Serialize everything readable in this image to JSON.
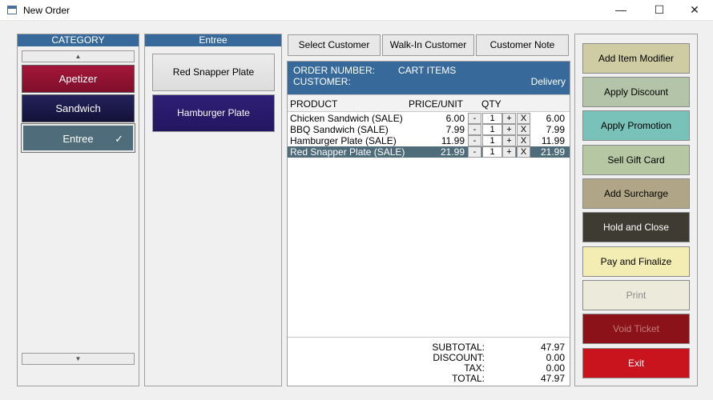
{
  "window": {
    "title": "New Order",
    "min_glyph": "—",
    "max_glyph": "☐",
    "close_glyph": "✕"
  },
  "category": {
    "header": "CATEGORY",
    "scroll_up": "▲",
    "scroll_down": "▼",
    "items": [
      {
        "label": "Apetizer",
        "color": "#a5163a",
        "selected": false
      },
      {
        "label": "Sandwich",
        "color": "#1c1a4a",
        "selected": false
      },
      {
        "label": "Entree",
        "color": "#4f6c7b",
        "selected": true,
        "check": "✓"
      }
    ]
  },
  "items_panel": {
    "header": "Entree",
    "items": [
      {
        "label": "Red Snapper Plate",
        "color": "#e6e6e6",
        "text_color": "#000000"
      },
      {
        "label": "Hamburger Plate",
        "color": "#2b1c6c",
        "text_color": "#ffffff"
      }
    ]
  },
  "top_buttons": {
    "select_customer": "Select Customer",
    "walk_in": "Walk-In Customer",
    "customer_note": "Customer Note"
  },
  "order": {
    "order_number_label": "ORDER NUMBER:",
    "cart_items_label": "CART ITEMS",
    "customer_label": "CUSTOMER:",
    "order_type": "Delivery",
    "columns": {
      "product": "PRODUCT",
      "price": "PRICE/UNIT",
      "qty": "QTY"
    },
    "qty_minus": "-",
    "qty_plus": "+",
    "remove": "X",
    "rows": [
      {
        "product": "Chicken Sandwich (SALE)",
        "price": "6.00",
        "qty": "1",
        "total": "6.00",
        "selected": false
      },
      {
        "product": "BBQ Sandwich (SALE)",
        "price": "7.99",
        "qty": "1",
        "total": "7.99",
        "selected": false
      },
      {
        "product": "Hamburger Plate (SALE)",
        "price": "11.99",
        "qty": "1",
        "total": "11.99",
        "selected": false
      },
      {
        "product": "Red Snapper Plate (SALE)",
        "price": "21.99",
        "qty": "1",
        "total": "21.99",
        "selected": true
      }
    ],
    "totals": {
      "subtotal_label": "SUBTOTAL:",
      "subtotal": "47.97",
      "discount_label": "DISCOUNT:",
      "discount": "0.00",
      "tax_label": "TAX:",
      "tax": "0.00",
      "total_label": "TOTAL:",
      "total": "47.97"
    }
  },
  "actions": [
    {
      "label": "Add Item Modifier",
      "bg": "#cfcca3",
      "fg": "#000000",
      "name": "add-item-modifier-button"
    },
    {
      "label": "Apply Discount",
      "bg": "#b4c4a9",
      "fg": "#000000",
      "name": "apply-discount-button"
    },
    {
      "label": "Apply Promotion",
      "bg": "#78c2b9",
      "fg": "#000000",
      "name": "apply-promotion-button"
    },
    {
      "label": "Sell Gift Card",
      "bg": "#b6c7a4",
      "fg": "#000000",
      "name": "sell-gift-card-button"
    },
    {
      "label": "Add Surcharge",
      "bg": "#b0a687",
      "fg": "#000000",
      "name": "add-surcharge-button"
    },
    {
      "label": "Hold and Close",
      "bg": "#3e3b33",
      "fg": "#ffffff",
      "name": "hold-and-close-button"
    },
    {
      "label": "Pay and Finalize",
      "bg": "#f3edb3",
      "fg": "#000000",
      "name": "pay-and-finalize-button"
    },
    {
      "label": "Print",
      "bg": "#eceadb",
      "fg": "#8a8a8a",
      "name": "print-button"
    },
    {
      "label": "Void Ticket",
      "bg": "#8b1218",
      "fg": "#c27a7a",
      "name": "void-ticket-button"
    },
    {
      "label": "Exit",
      "bg": "#c9141e",
      "fg": "#ffffff",
      "name": "exit-button"
    }
  ]
}
